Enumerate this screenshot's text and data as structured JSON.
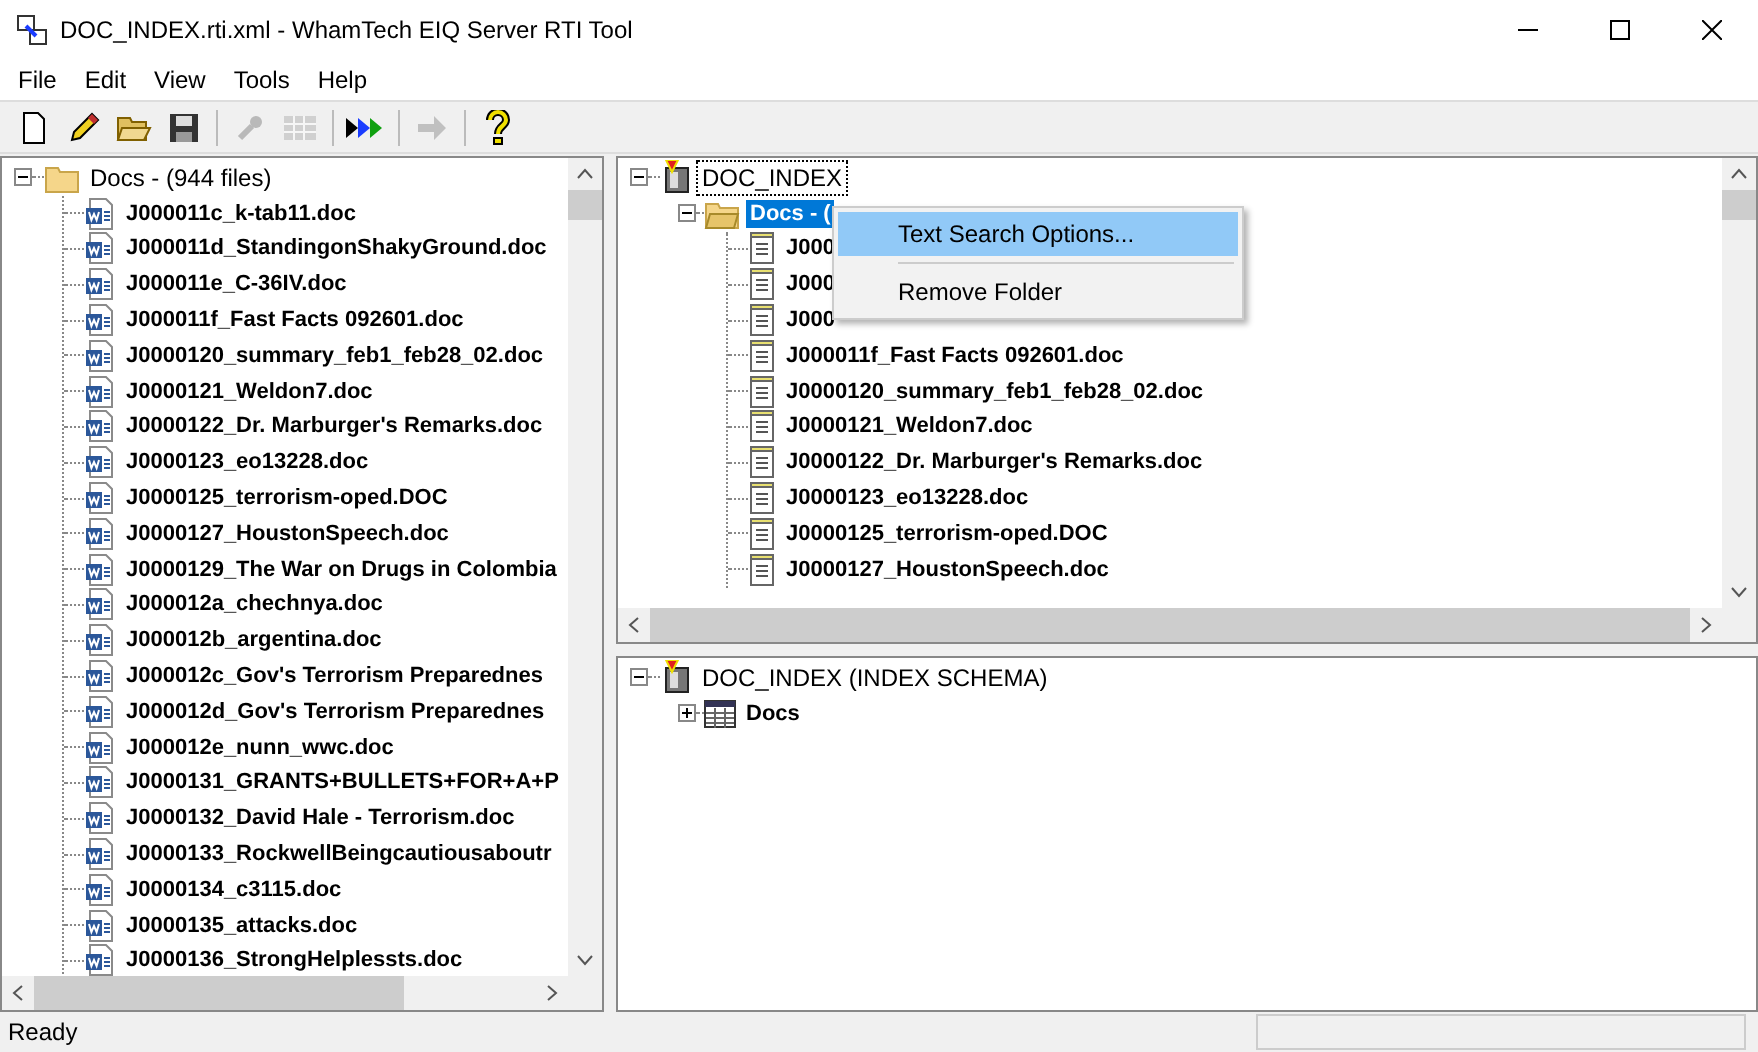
{
  "window": {
    "title": "DOC_INDEX.rti.xml - WhamTech EIQ Server RTI Tool"
  },
  "menu": [
    "File",
    "Edit",
    "View",
    "Tools",
    "Help"
  ],
  "toolbar": [
    {
      "kind": "new",
      "disabled": false
    },
    {
      "kind": "edit",
      "disabled": false
    },
    {
      "kind": "open",
      "disabled": false
    },
    {
      "kind": "save",
      "disabled": false
    },
    {
      "kind": "sep"
    },
    {
      "kind": "wrench",
      "disabled": true
    },
    {
      "kind": "grid",
      "disabled": true
    },
    {
      "kind": "sep"
    },
    {
      "kind": "run",
      "disabled": false
    },
    {
      "kind": "sep"
    },
    {
      "kind": "arrow",
      "disabled": true
    },
    {
      "kind": "sep"
    },
    {
      "kind": "help",
      "disabled": false
    }
  ],
  "left_tree": {
    "label": "Docs - (944 files)",
    "expanded": true,
    "children": [
      {
        "label": "J000011c_k-tab11.doc"
      },
      {
        "label": "J000011d_StandingonShakyGround.doc"
      },
      {
        "label": "J000011e_C-36IV.doc"
      },
      {
        "label": "J000011f_Fast Facts 092601.doc"
      },
      {
        "label": "J0000120_summary_feb1_feb28_02.doc"
      },
      {
        "label": "J0000121_Weldon7.doc"
      },
      {
        "label": "J0000122_Dr. Marburger's Remarks.doc"
      },
      {
        "label": "J0000123_eo13228.doc"
      },
      {
        "label": "J0000125_terrorism-oped.DOC"
      },
      {
        "label": "J0000127_HoustonSpeech.doc"
      },
      {
        "label": "J0000129_The War on Drugs in Colombia"
      },
      {
        "label": "J000012a_chechnya.doc"
      },
      {
        "label": "J000012b_argentina.doc"
      },
      {
        "label": "J000012c_Gov's  Terrorism Preparednes"
      },
      {
        "label": "J000012d_Gov's  Terrorism Preparednes"
      },
      {
        "label": "J000012e_nunn_wwc.doc"
      },
      {
        "label": "J0000131_GRANTS+BULLETS+FOR+A+P"
      },
      {
        "label": "J0000132_David Hale - Terrorism.doc"
      },
      {
        "label": "J0000133_RockwellBeingcautiousaboutr"
      },
      {
        "label": "J0000134_c3115.doc"
      },
      {
        "label": "J0000135_attacks.doc"
      },
      {
        "label": "J0000136_StrongHelplessts.doc"
      }
    ]
  },
  "right_tree": {
    "label": "DOC_INDEX",
    "expanded": true,
    "selected": false,
    "children": [
      {
        "label": "Docs - (",
        "expanded": true,
        "selected": true,
        "children": [
          {
            "label": "J000",
            "selected": false
          },
          {
            "label": "J000",
            "selected": false
          },
          {
            "label": "J000",
            "selected": false
          },
          {
            "label": "J000011f_Fast Facts 092601.doc",
            "selected": false
          },
          {
            "label": "J0000120_summary_feb1_feb28_02.doc",
            "selected": false
          },
          {
            "label": "J0000121_Weldon7.doc",
            "selected": false
          },
          {
            "label": "J0000122_Dr. Marburger's Remarks.doc",
            "selected": false
          },
          {
            "label": "J0000123_eo13228.doc",
            "selected": false
          },
          {
            "label": "J0000125_terrorism-oped.DOC",
            "selected": false
          },
          {
            "label": "J0000127_HoustonSpeech.doc",
            "selected": false
          }
        ]
      }
    ]
  },
  "context_menu": [
    {
      "label": "Text Search Options...",
      "selected": true
    },
    {
      "label": "Remove Folder",
      "selected": false
    }
  ],
  "schema_tree": {
    "label": "DOC_INDEX (INDEX SCHEMA)",
    "expanded": true,
    "children": [
      {
        "label": "Docs",
        "expanded": false
      }
    ]
  },
  "status_bar": {
    "text": "Ready"
  }
}
